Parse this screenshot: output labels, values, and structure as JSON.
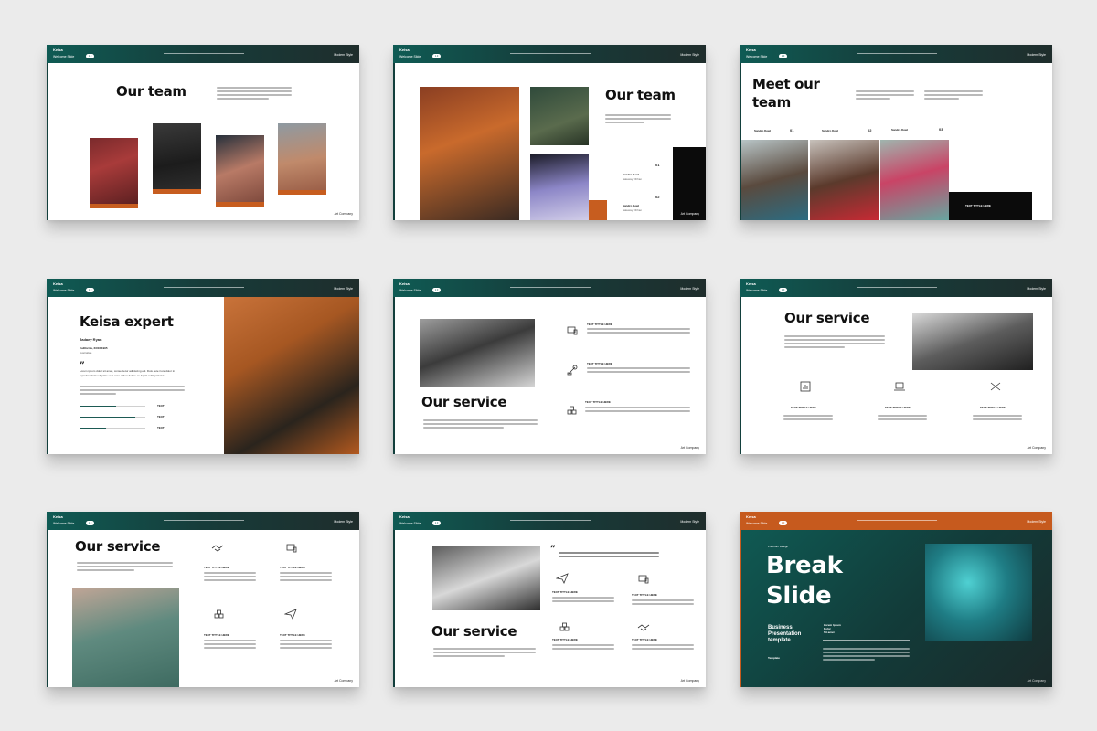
{
  "header": {
    "brand": "Keisa",
    "sub": "Welcome Slide",
    "pill": "1.0",
    "right": "Modern Style"
  },
  "footer": {
    "company": "Art Company"
  },
  "colors": {
    "teal": "#0f5b54",
    "dark": "#1f2d2c",
    "orange": "#c65a1e"
  },
  "slides": {
    "s1": {
      "title": "Our team"
    },
    "s2": {
      "title": "Our team",
      "members": [
        {
          "num": "01",
          "name": "Sandro Bewi",
          "role": "Saleway Ohhiei"
        },
        {
          "num": "02",
          "name": "Sandro Bewi",
          "role": "Saleway Ohhiei"
        }
      ]
    },
    "s3": {
      "title_line1": "Meet our",
      "title_line2": "team",
      "members": [
        {
          "num": "01",
          "name": "Sandro Dewi"
        },
        {
          "num": "02",
          "name": "Sandro Dewi"
        },
        {
          "num": "03",
          "name": "Sandro Dewi"
        }
      ],
      "box_text": "TEXT TITTLE HERE"
    },
    "s4": {
      "title": "Keisa expert",
      "name": "Jadaey Ryan",
      "location": "California, 23/16/1995",
      "country": "Australian",
      "quote_mark": "”",
      "quote_text": "Lorem ipsum dolor sit amet, consectetur adipiscing elit. Duis aute irure dolor in reprehenderit voluptate velit esse cillum dolore eu fugiat nulla pariatur.",
      "skills": [
        {
          "label": "TEXT",
          "level": 0.55
        },
        {
          "label": "TEXT",
          "level": 0.85
        },
        {
          "label": "TEXT",
          "level": 0.4
        }
      ]
    },
    "s5": {
      "title": "Our service",
      "items": [
        "TEXT TITTLE HERE",
        "TEXT TITTLE HERE",
        "TEXT TITTLE HERE"
      ]
    },
    "s6": {
      "title": "Our service",
      "items": [
        "TEXT TITTLE HERE",
        "TEXT TITTLE HERE",
        "TEXT TITTLE HERE"
      ]
    },
    "s7": {
      "title": "Our service",
      "items": [
        "TEXT TITTLE HERE",
        "TEXT TITTLE HERE",
        "TEXT TITTLE HERE",
        "TEXT TITTLE HERE"
      ]
    },
    "s8": {
      "title": "Our service",
      "quote_mark": "”",
      "items": [
        "TEXT TITTLE HERE",
        "TEXT TITTLE HERE",
        "TEXT TITTLE HERE",
        "TEXT TITTLE HERE"
      ]
    },
    "s9": {
      "label": "Premium Design",
      "title_line1": "Break",
      "title_line2": "Slide",
      "sub_line1": "Business",
      "sub_line2": "Presentation",
      "sub_line3": "template.",
      "template": "Template",
      "meta_line1": "Lorem Ipsum",
      "meta_line2": "Dolor",
      "meta_line3": "Sit amet"
    }
  }
}
